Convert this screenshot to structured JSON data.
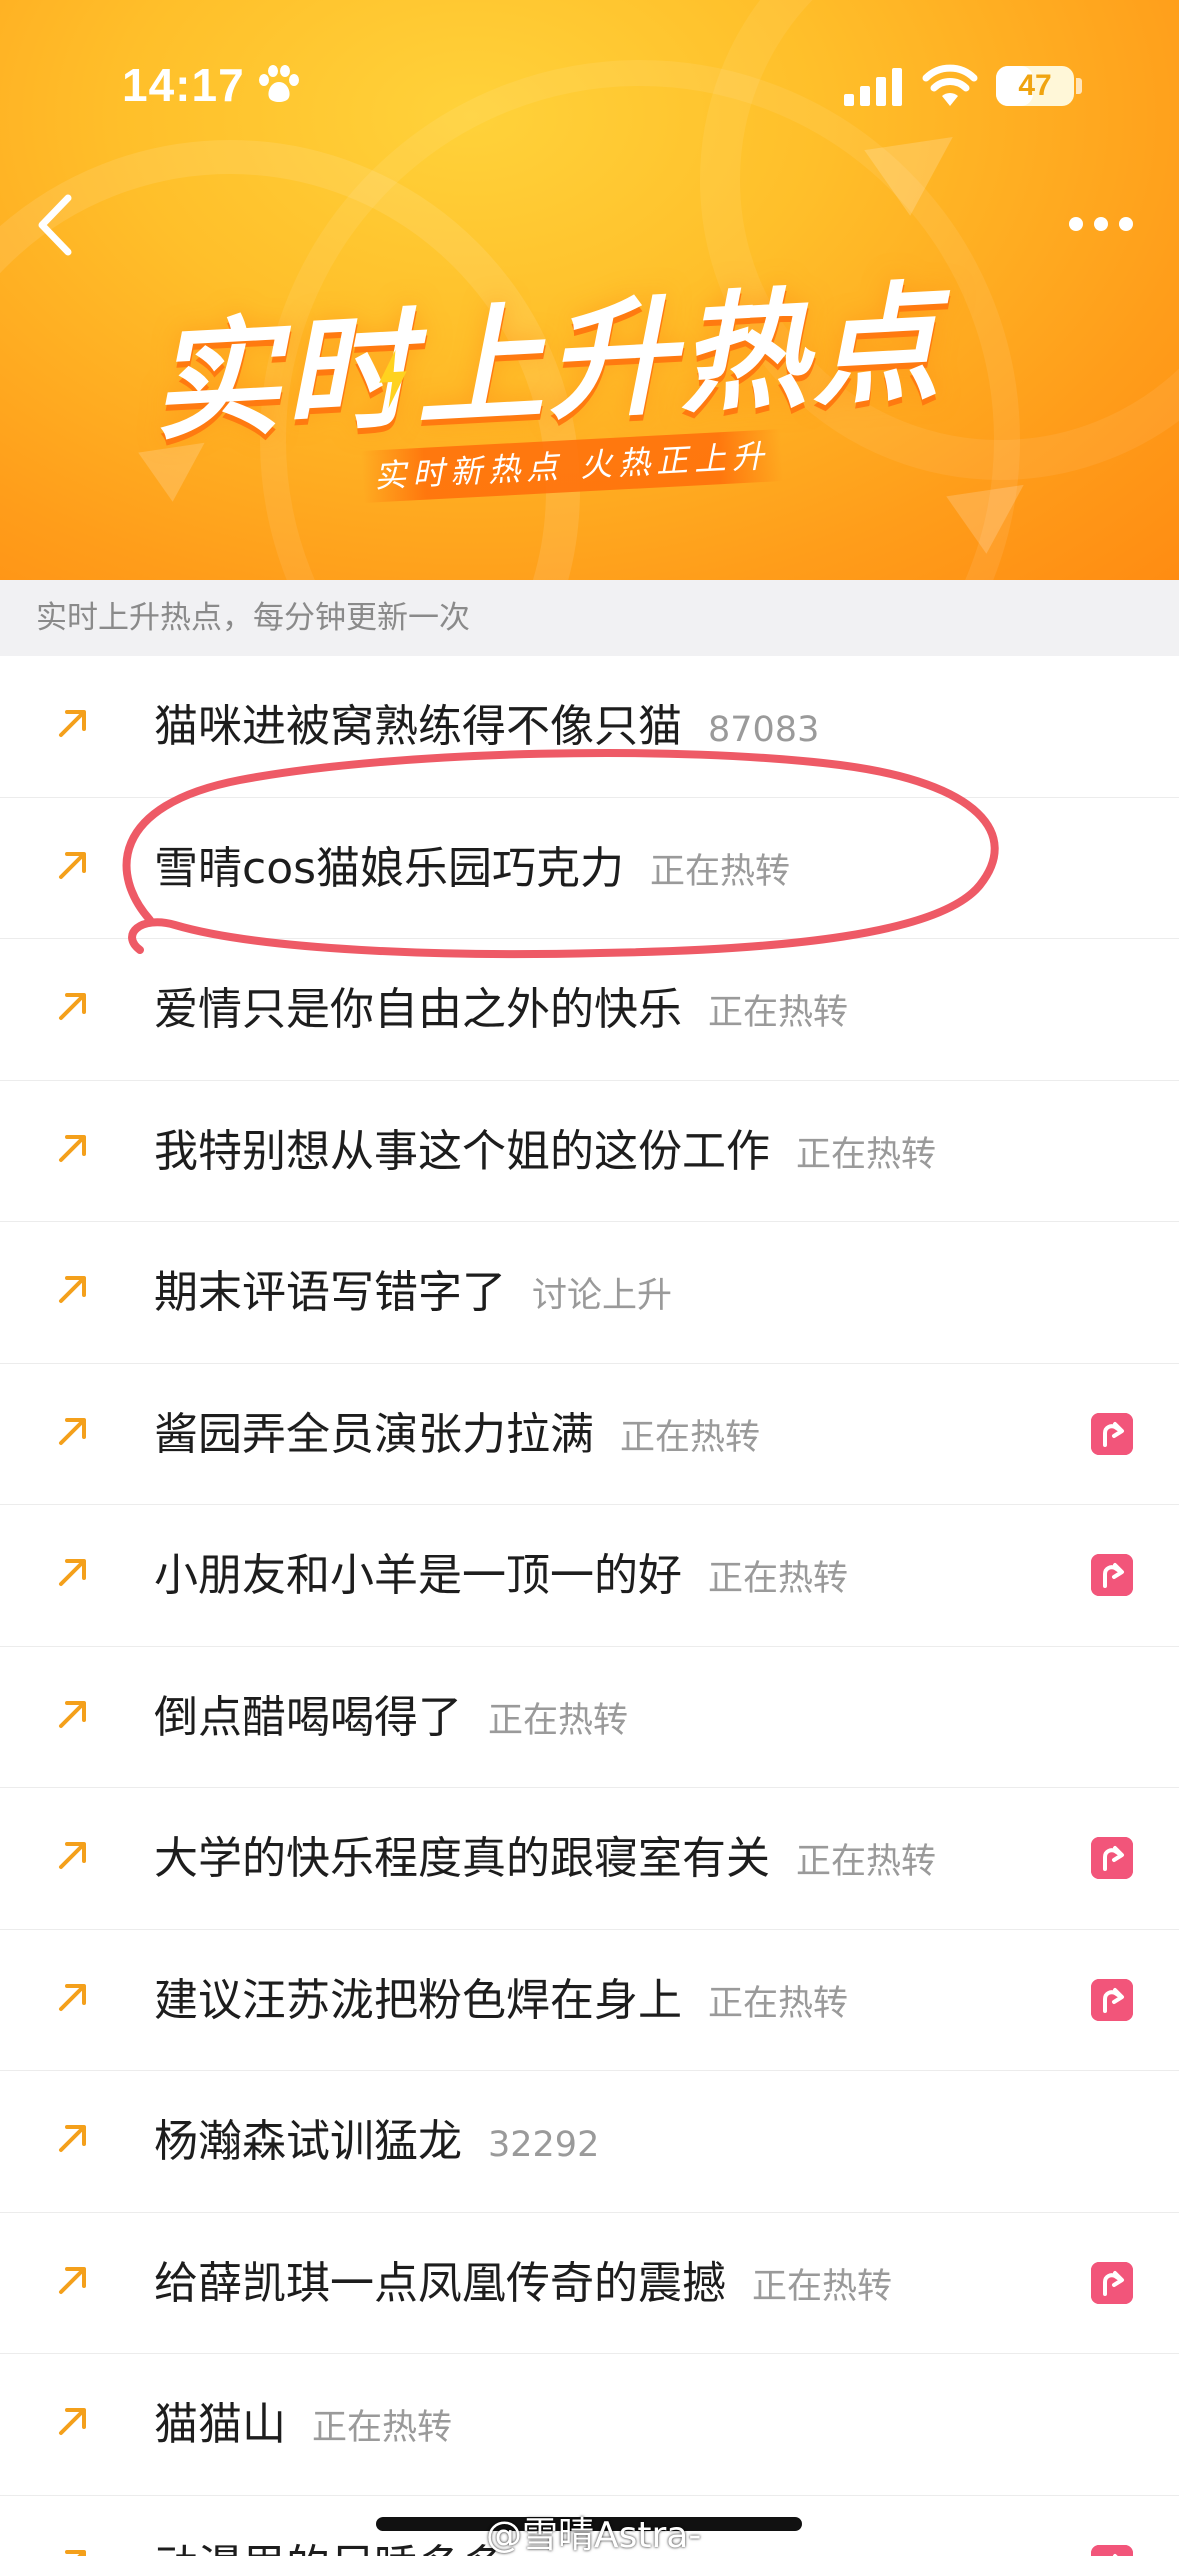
{
  "status_bar": {
    "time": "14:17",
    "battery": "47",
    "battery_level": 0.47
  },
  "header": {
    "title": "实时上升热点",
    "subtitle": "实时新热点 火热正上升",
    "back_icon": "chevron-left-icon",
    "more_icon": "more-dots-icon"
  },
  "info_strip": {
    "text": "实时上升热点，每分钟更新一次"
  },
  "list": {
    "items": [
      {
        "title": "猫咪进被窝熟练得不像只猫",
        "tag": "87083",
        "badge": false
      },
      {
        "title": "雪晴cos猫娘乐园巧克力",
        "tag": "正在热转",
        "badge": false
      },
      {
        "title": "爱情只是你自由之外的快乐",
        "tag": "正在热转",
        "badge": false
      },
      {
        "title": "我特别想从事这个姐的这份工作",
        "tag": "正在热转",
        "badge": false
      },
      {
        "title": "期末评语写错字了",
        "tag": "讨论上升",
        "badge": false
      },
      {
        "title": "酱园弄全员演张力拉满",
        "tag": "正在热转",
        "badge": true
      },
      {
        "title": "小朋友和小羊是一顶一的好",
        "tag": "正在热转",
        "badge": true
      },
      {
        "title": "倒点醋喝喝得了",
        "tag": "正在热转",
        "badge": false
      },
      {
        "title": "大学的快乐程度真的跟寝室有关",
        "tag": "正在热转",
        "badge": true
      },
      {
        "title": "建议汪苏泷把粉色焊在身上",
        "tag": "正在热转",
        "badge": true
      },
      {
        "title": "杨瀚森试训猛龙",
        "tag": "32292",
        "badge": false
      },
      {
        "title": "给薛凯琪一点凤凰传奇的震撼",
        "tag": "正在热转",
        "badge": true
      },
      {
        "title": "猫猫山",
        "tag": "正在热转",
        "badge": false
      },
      {
        "title": "动漫里的尽睡多多",
        "tag": "",
        "badge": true
      }
    ]
  },
  "watermark": "@雪晴Astra-",
  "colors": {
    "banner_start": "#ffd23a",
    "banner_end": "#ff8c12",
    "trend_arrow": "#f4a01b",
    "badge": "#f2557a",
    "annotation": "#ee5a66"
  }
}
